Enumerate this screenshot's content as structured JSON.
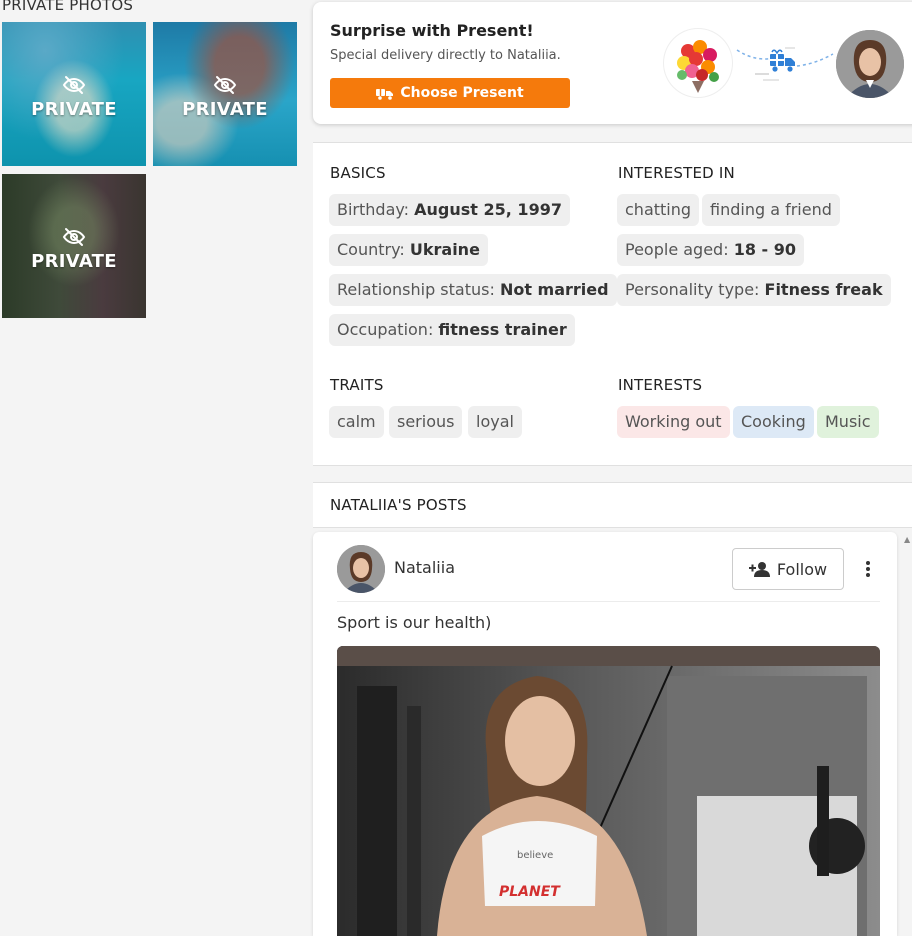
{
  "private_photos": {
    "title": "PRIVATE PHOTOS",
    "items": [
      {
        "label": "PRIVATE"
      },
      {
        "label": "PRIVATE"
      },
      {
        "label": "PRIVATE"
      }
    ],
    "icon": "eye-slash-icon"
  },
  "present": {
    "title": "Surprise with Present!",
    "subtitle": "Special delivery directly to Nataliia.",
    "button_label": "Choose Present",
    "button_icon": "truck-gift-icon",
    "accent_color": "#f57a0c",
    "flowers_icon": "flower-bouquet-icon",
    "delivery_icon": "delivery-truck-icon"
  },
  "basics": {
    "title": "BASICS",
    "items": [
      {
        "label": "Birthday: ",
        "value": "August 25, 1997"
      },
      {
        "label": "Country: ",
        "value": "Ukraine"
      },
      {
        "label": "Relationship status: ",
        "value": "Not married"
      },
      {
        "label": "Occupation: ",
        "value": "fitness trainer"
      }
    ]
  },
  "interested_in": {
    "title": "INTERESTED IN",
    "tags": [
      "chatting",
      "finding a friend"
    ],
    "age": {
      "label": "People aged: ",
      "value": "18 - 90"
    },
    "personality": {
      "label": "Personality type: ",
      "value": "Fitness freak"
    }
  },
  "traits": {
    "title": "TRAITS",
    "items": [
      "calm",
      "serious",
      "loyal"
    ]
  },
  "interests": {
    "title": "INTERESTS",
    "items": [
      {
        "label": "Working out",
        "color": "#fbe7e7"
      },
      {
        "label": "Cooking",
        "color": "#dde9f6"
      },
      {
        "label": "Music",
        "color": "#e0f2dc"
      }
    ]
  },
  "posts": {
    "title": "NATALIIA'S POSTS",
    "post": {
      "author": "Nataliia",
      "follow_label": "Follow",
      "follow_icon": "add-person-icon",
      "more_icon": "more-vertical-icon",
      "text": "Sport is our health)",
      "image_text": "believe",
      "image_brand": "PLANET"
    }
  }
}
